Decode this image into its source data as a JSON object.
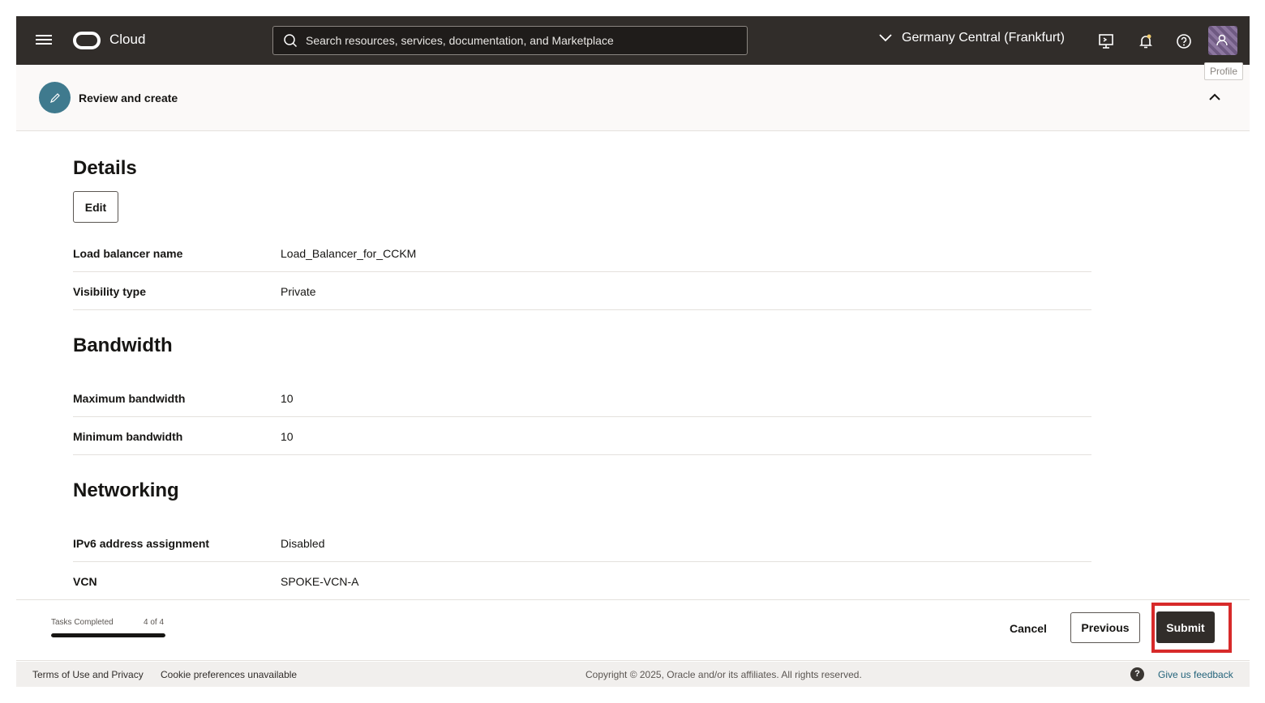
{
  "header": {
    "brand": "Cloud",
    "search_placeholder": "Search resources, services, documentation, and Marketplace",
    "region": "Germany Central (Frankfurt)",
    "profile_tooltip": "Profile"
  },
  "step": {
    "title": "Review and create"
  },
  "sections": {
    "details": {
      "title": "Details",
      "edit_label": "Edit",
      "rows": [
        {
          "key": "Load balancer name",
          "value": "Load_Balancer_for_CCKM"
        },
        {
          "key": "Visibility type",
          "value": "Private"
        }
      ]
    },
    "bandwidth": {
      "title": "Bandwidth",
      "rows": [
        {
          "key": "Maximum bandwidth",
          "value": "10"
        },
        {
          "key": "Minimum bandwidth",
          "value": "10"
        }
      ]
    },
    "networking": {
      "title": "Networking",
      "rows": [
        {
          "key": "IPv6 address assignment",
          "value": "Disabled"
        },
        {
          "key": "VCN",
          "value": "SPOKE-VCN-A"
        }
      ]
    }
  },
  "action_bar": {
    "tasks_label": "Tasks Completed",
    "tasks_count": "4 of 4",
    "progress_fraction": 1.0,
    "cancel": "Cancel",
    "previous": "Previous",
    "submit": "Submit"
  },
  "footer": {
    "terms": "Terms of Use and Privacy",
    "cookie": "Cookie preferences unavailable",
    "copyright": "Copyright © 2025, Oracle and/or its affiliates. All rights reserved.",
    "feedback": "Give us feedback",
    "help_glyph": "?"
  },
  "colors": {
    "header_bg": "#312d2a",
    "accent_teal": "#3f7a8e",
    "highlight_red": "#d72a2a",
    "link": "#23637a"
  },
  "icons": [
    "hamburger-icon",
    "oracle-logo",
    "search-icon",
    "chevron-down-icon",
    "cloud-shell-icon",
    "bell-icon",
    "help-icon",
    "profile-icon",
    "pencil-icon",
    "chevron-up-icon"
  ]
}
